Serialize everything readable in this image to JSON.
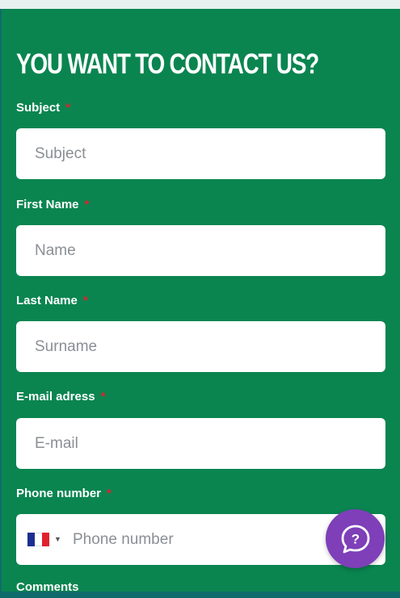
{
  "form": {
    "title": "YOU WANT TO CONTACT US?",
    "required_mark": "*",
    "subject": {
      "label": "Subject",
      "placeholder": "Subject",
      "value": ""
    },
    "first_name": {
      "label": "First Name",
      "placeholder": "Name",
      "value": ""
    },
    "last_name": {
      "label": "Last Name",
      "placeholder": "Surname",
      "value": ""
    },
    "email": {
      "label": "E-mail adress",
      "placeholder": "E-mail",
      "value": ""
    },
    "phone": {
      "label": "Phone number",
      "placeholder": "Phone number",
      "country_flag": "france-flag-icon",
      "value": ""
    },
    "comments": {
      "label": "Comments"
    }
  },
  "help": {
    "icon": "question-chat-icon",
    "glyph": "?"
  },
  "colors": {
    "background": "#0a8550",
    "required": "#e0212e",
    "help_button": "#7e3fb8",
    "field_bg": "#ffffff"
  }
}
